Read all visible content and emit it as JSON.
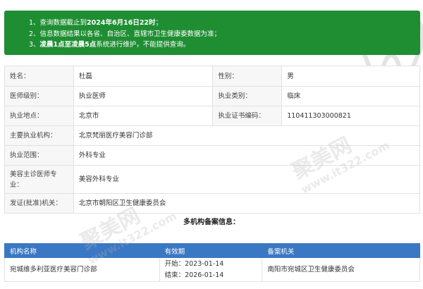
{
  "notice": {
    "line1": {
      "prefix": "1、查询数据截止到",
      "bold": "2024年6月16日22时",
      "suffix": "；"
    },
    "line2": {
      "text": "2、信息数据结果以各省、自治区、直辖市卫生健康委数据为准；"
    },
    "line3": {
      "prefix": "3、",
      "bold": "凌晨1点至凌晨5点",
      "suffix": "系统进行维护，不能提供查询。"
    }
  },
  "info": {
    "name_label": "姓名：",
    "name": "杜磊",
    "gender_label": "性别：",
    "gender": "男",
    "level_label": "医师级别：",
    "level": "执业医师",
    "category_label": "执业类别：",
    "category": "临床",
    "place_label": "执业地点：",
    "place": "北京市",
    "cert_label": "执业证书编码：",
    "cert": "110411303000821",
    "org_label": "主要执业机构：",
    "org": "北京梵丽医疗美容门诊部",
    "scope_label": "执业范围：",
    "scope": "外科专业",
    "cosmetic_label": "美容主诊医师专业：",
    "cosmetic": "美容外科专业",
    "issuer_label": "发证(批准)机关：",
    "issuer": "北京市朝阳区卫生健康委员会"
  },
  "multi": {
    "title": "多机构备案信息：",
    "headers": [
      "机构名称",
      "有效期",
      "备案机关"
    ],
    "row": {
      "name": "宛城维多利亚医疗美容门诊部",
      "start": "开始：2023-01-14",
      "end": "结束：2026-01-14",
      "authority": "南阳市宛城区卫生健康委员会"
    }
  },
  "watermark": {
    "text": "聚美网",
    "url": "www.it322.com"
  },
  "colors": {
    "notice_bg": "#1f8e33",
    "table_header": "#3b78c3",
    "key_bg": "#f7f7f7"
  }
}
